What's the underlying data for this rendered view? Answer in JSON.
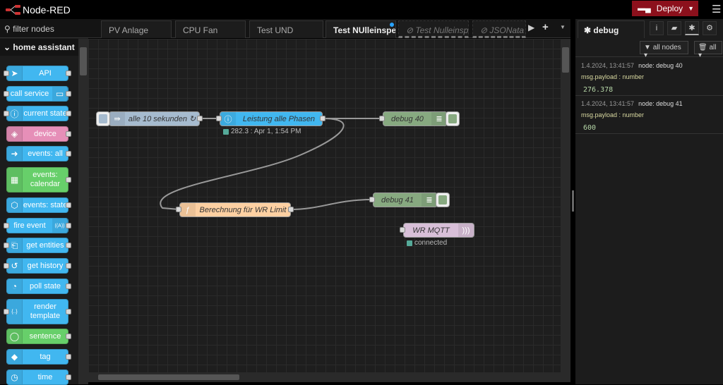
{
  "header": {
    "title": "Node-RED",
    "deploy_label": "Deploy",
    "menu_icon": "hamburger-icon"
  },
  "palette": {
    "filter_placeholder": "filter nodes",
    "category": "home assistant",
    "nodes": [
      {
        "label": "API",
        "color": "#41b7f0",
        "icon": "paper-plane-icon"
      },
      {
        "label": "call service",
        "color": "#41b7f0",
        "icon": "router-icon"
      },
      {
        "label": "current state",
        "color": "#41b7f0",
        "icon": "info-icon"
      },
      {
        "label": "device",
        "color": "#e68fb8",
        "icon": "cube-icon"
      },
      {
        "label": "events: all",
        "color": "#41b7f0",
        "icon": "arrow-right-icon"
      },
      {
        "label": "events: calendar",
        "color": "#67cf6a",
        "icon": "calendar-icon"
      },
      {
        "label": "events: state",
        "color": "#41b7f0",
        "icon": "hexagon-arrow-icon"
      },
      {
        "label": "fire event",
        "color": "#41b7f0",
        "icon": "broadcast-icon"
      },
      {
        "label": "get entities",
        "color": "#41b7f0",
        "icon": "entities-icon"
      },
      {
        "label": "get history",
        "color": "#41b7f0",
        "icon": "history-icon"
      },
      {
        "label": "poll state",
        "color": "#41b7f0",
        "icon": "timer-icon"
      },
      {
        "label": "render template",
        "color": "#41b7f0",
        "icon": "braces-icon"
      },
      {
        "label": "sentence",
        "color": "#67cf6a",
        "icon": "speech-bubble-icon"
      },
      {
        "label": "tag",
        "color": "#41b7f0",
        "icon": "tag-icon"
      },
      {
        "label": "time",
        "color": "#41b7f0",
        "icon": "clock-icon"
      }
    ]
  },
  "tabs": [
    {
      "label": "PV Anlage"
    },
    {
      "label": "CPU Fan"
    },
    {
      "label": "Test UND"
    },
    {
      "label": "Test NUlleinspeisung",
      "active": true,
      "changed": true
    },
    {
      "label": "Test Nulleinspeisung",
      "disabled": true
    },
    {
      "label": "JSONata Funktion",
      "disabled": true
    }
  ],
  "flow": {
    "inject": {
      "label": "alle 10 sekunden ↻",
      "color": "#a6bbcf"
    },
    "current_state": {
      "label": "Leistung alle Phasen",
      "color": "#41b7f0",
      "status": "282.3 : Apr 1, 1:54 PM"
    },
    "debug40": {
      "label": "debug 40",
      "color": "#87a980"
    },
    "function": {
      "label": "Berechnung für WR Limit",
      "color": "#fdd0a2"
    },
    "debug41": {
      "label": "debug 41",
      "color": "#87a980"
    },
    "mqtt": {
      "label": "WR MQTT",
      "color": "#d8bfd8",
      "status": "connected"
    }
  },
  "sidebar": {
    "tab_label": "debug",
    "filter_label": "all nodes",
    "clear_label": "all",
    "messages": [
      {
        "time": "1.4.2024, 13:41:57",
        "node": "node: debug 40",
        "path": "msg.payload : number",
        "value": "276.378"
      },
      {
        "time": "1.4.2024, 13:41:57",
        "node": "node: debug 41",
        "path": "msg.payload : number",
        "value": "600"
      }
    ]
  }
}
